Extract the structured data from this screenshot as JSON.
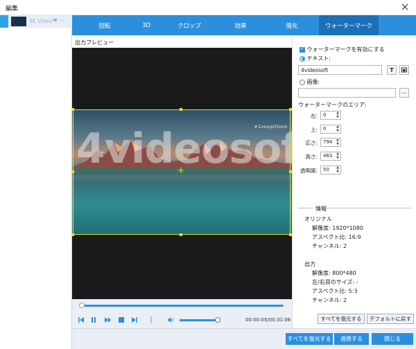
{
  "window": {
    "title": "編集"
  },
  "clip": {
    "name": "4K Video",
    "icons": "❤ ⋯"
  },
  "tabs": [
    {
      "label": "回転",
      "active": false
    },
    {
      "label": "3D",
      "active": false
    },
    {
      "label": "クロップ",
      "active": false
    },
    {
      "label": "効果",
      "active": false
    },
    {
      "label": "強化",
      "active": false
    },
    {
      "label": "ウォーターマーク",
      "active": true
    }
  ],
  "preview": {
    "label": "出力プレビュー",
    "watermark_text": "4videosoft",
    "logo_text": "✷ LoungeVision"
  },
  "player": {
    "time": "00:00:05/00:31:06"
  },
  "watermark": {
    "enable_label": "ウォーターマークを有効にする",
    "text_label": "テキスト:",
    "text_value": "4videosoft",
    "image_label": "画像:",
    "image_path": "",
    "area_label": "ウォーターマークのエリア:",
    "fields": [
      {
        "label": "左:",
        "value": "0"
      },
      {
        "label": "上:",
        "value": "0"
      },
      {
        "label": "広さ:",
        "value": "794"
      },
      {
        "label": "高さ:",
        "value": "463"
      },
      {
        "label": "透明度:",
        "value": "50"
      }
    ]
  },
  "info": {
    "heading": "情報",
    "original_heading": "オリジナル",
    "original": [
      "解像度: 1920*1080",
      "アスペクト比: 16:9",
      "チャンネル: 2"
    ],
    "output_heading": "出力",
    "output": [
      "解像度: 800*480",
      "左/右目のサイズ: -",
      "アスペクト比: 5:3",
      "チャンネル: 2"
    ]
  },
  "buttons": {
    "restore_all": "すべてを復元する",
    "reset_default": "デフォルトに戻す",
    "footer_restore_all": "すべてを復元する",
    "apply": "適用する",
    "close": "閉じる"
  },
  "colors": {
    "accent": "#2c8fde",
    "tab_active": "#1d6fb8",
    "selection": "#e5e22b"
  }
}
